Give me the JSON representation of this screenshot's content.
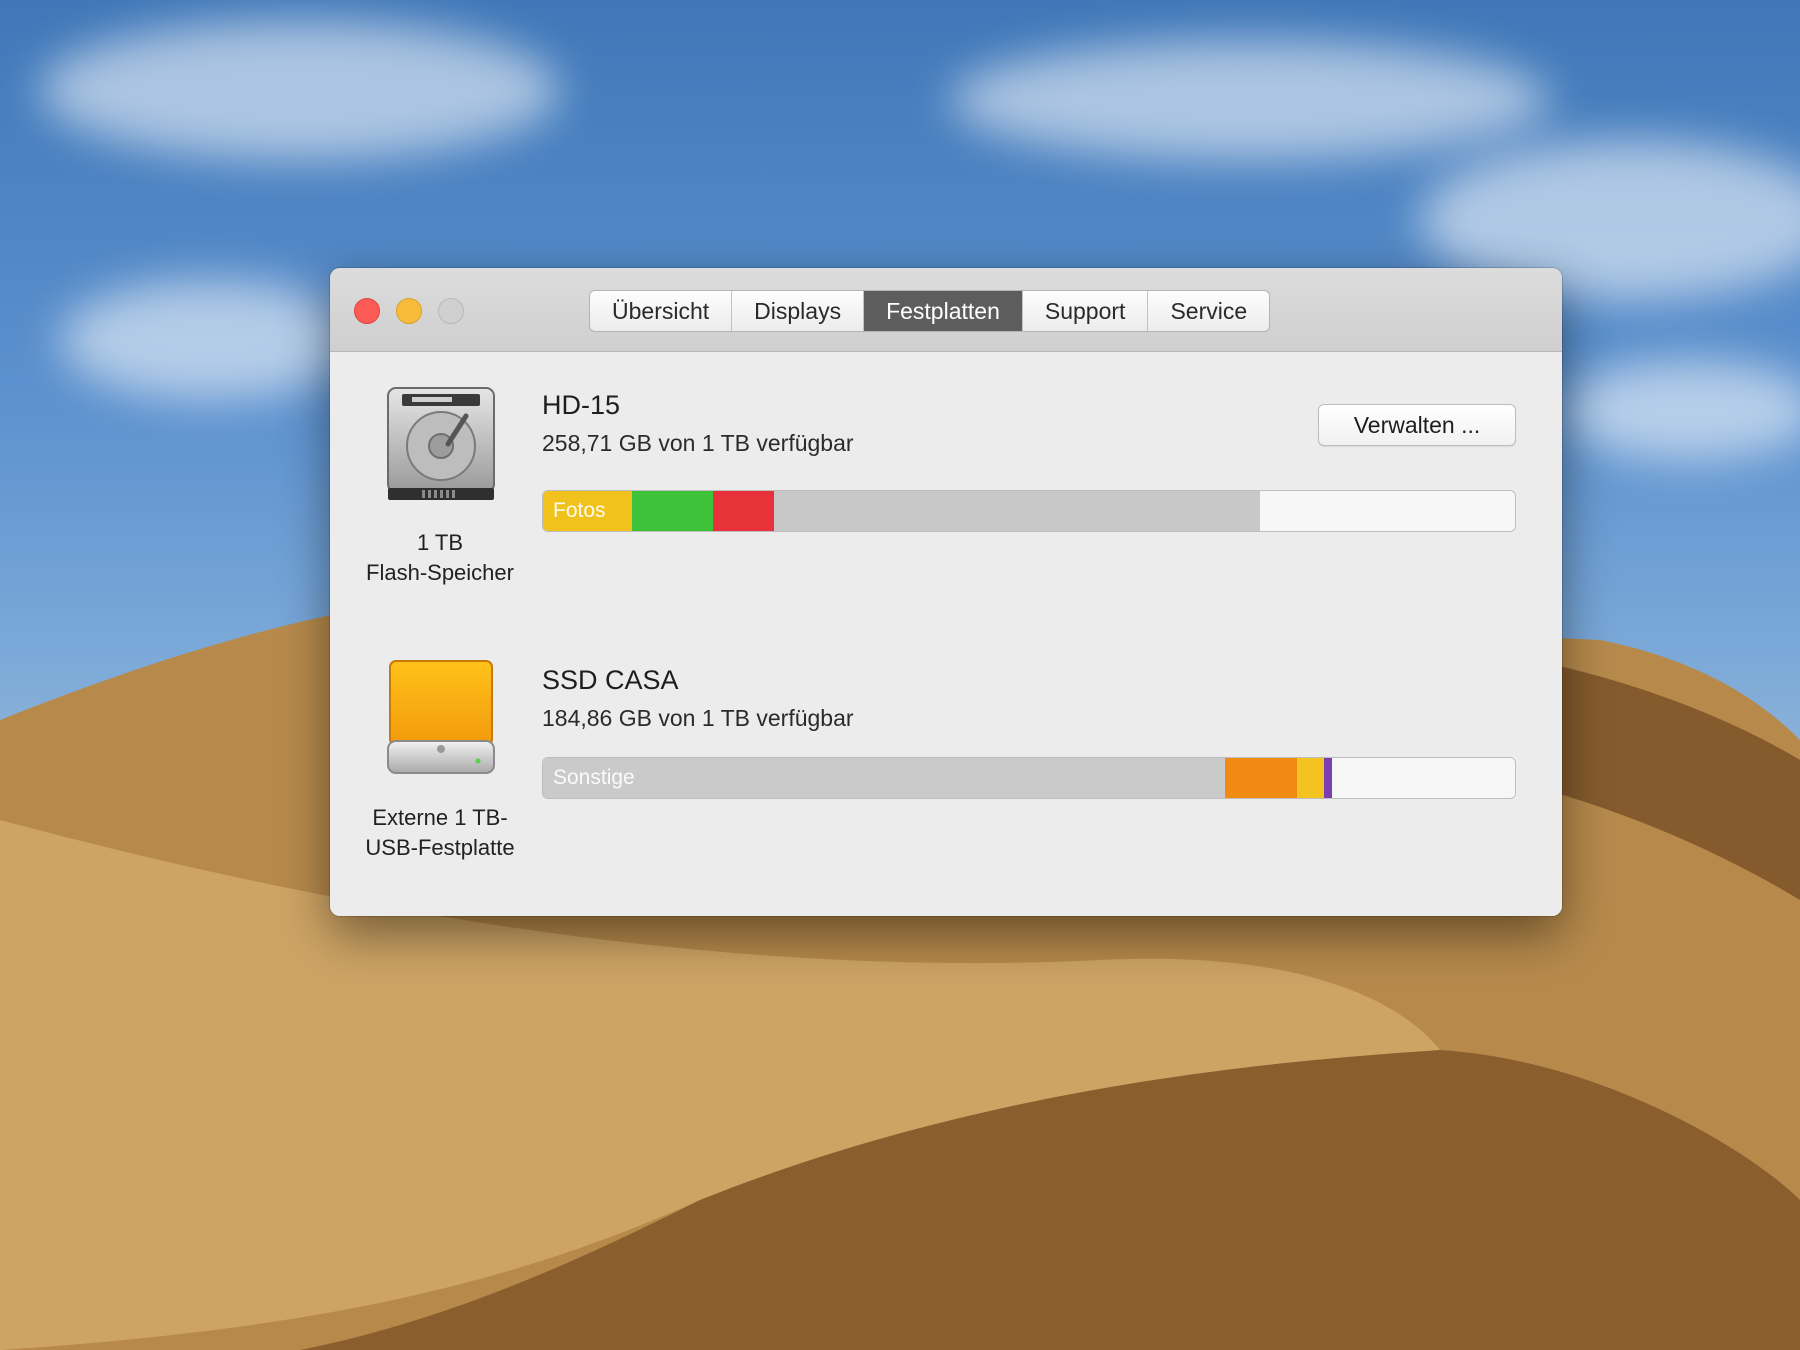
{
  "window": {
    "tabs": [
      {
        "label": "Übersicht",
        "active": false
      },
      {
        "label": "Displays",
        "active": false
      },
      {
        "label": "Festplatten",
        "active": true
      },
      {
        "label": "Support",
        "active": false
      },
      {
        "label": "Service",
        "active": false
      }
    ]
  },
  "disks": [
    {
      "name": "HD-15",
      "free_text": "258,71 GB von 1 TB verfügbar",
      "caption_line1": "1 TB",
      "caption_line2": "Flash-Speicher",
      "icon": "internal-hard-drive-icon",
      "manage_label": "Verwalten ...",
      "usage": [
        {
          "label": "Fotos",
          "fraction": 0.092,
          "color": "#f2c21c"
        },
        {
          "fraction": 0.083,
          "color": "#3ec23a"
        },
        {
          "fraction": 0.063,
          "color": "#e8323a"
        },
        {
          "fraction": 0.5,
          "color": "#c8c8c8"
        },
        {
          "fraction": 0.262,
          "color": "#f7f7f7"
        }
      ]
    },
    {
      "name": "SSD CASA",
      "free_text": "184,86 GB von 1 TB verfügbar",
      "caption_line1": "Externe 1 TB-",
      "caption_line2": "USB-Festplatte",
      "icon": "external-usb-drive-icon",
      "usage": [
        {
          "label": "Sonstige",
          "fraction": 0.702,
          "color": "#cacaca"
        },
        {
          "fraction": 0.074,
          "color": "#f08a12"
        },
        {
          "fraction": 0.028,
          "color": "#f4c320"
        },
        {
          "fraction": 0.008,
          "color": "#7a3fb0"
        },
        {
          "fraction": 0.188,
          "color": "#f7f7f7"
        }
      ]
    }
  ]
}
